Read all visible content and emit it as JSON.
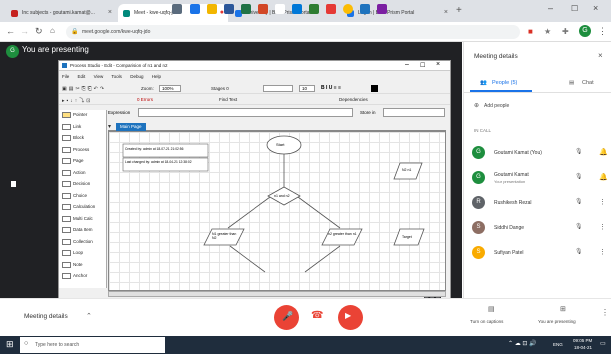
{
  "browser": {
    "tabs": [
      {
        "title": "Inc subjects - goutami.kamat@...",
        "color": "#c5221f"
      },
      {
        "title": "Meet - kwe-uqfq-jdo",
        "color": "#00897b"
      },
      {
        "title": "University | Blue Prism Portal",
        "color": "#1a73e8"
      },
      {
        "title": "Log in | Blue Prism Portal",
        "color": "#1a73e8"
      }
    ],
    "url": "meet.google.com/kwe-uqfq-jdo"
  },
  "meet": {
    "presenting_banner": "You are presenting",
    "presenter_initial": "G",
    "panel_title": "Meeting details",
    "panel_tabs": [
      "People (5)",
      "Chat"
    ],
    "add_people": "Add people",
    "in_call_label": "IN CALL",
    "participants": [
      {
        "name": "Goutami Kamat (You)",
        "sub": "",
        "initial": "G",
        "color": "#1e8e3e"
      },
      {
        "name": "Goutami Kamat",
        "sub": "Your presentation",
        "initial": "G",
        "color": "#1e8e3e"
      },
      {
        "name": "Rushikesh Rezal",
        "sub": "",
        "initial": "R",
        "color": "#5f6368"
      },
      {
        "name": "Siddhi Dange",
        "sub": "",
        "initial": "S",
        "color": "#8d6e63"
      },
      {
        "name": "Sufiyan Patel",
        "sub": "",
        "initial": "S",
        "color": "#f9ab00"
      }
    ],
    "bottom": {
      "meeting_details": "Meeting details",
      "captions": "Turn on captions",
      "presenting": "You are presenting"
    }
  },
  "process_studio": {
    "title": "Process Studio - Edit - Comparision of n1 and n2",
    "menu": [
      "File",
      "Edit",
      "View",
      "Tools",
      "Debug",
      "Help"
    ],
    "zoom_label": "Zoom:",
    "zoom_value": "100%",
    "stage_label": "Stages 0",
    "font_size": "10",
    "dependencies": "Dependencies",
    "errors_label": "0 Errors",
    "find_text": "Find Text",
    "expression_label": "Expression",
    "store_in_label": "Store in",
    "page_tab": "Main Page",
    "palette": [
      "Pointer",
      "Link",
      "Block",
      "Process",
      "Page",
      "Action",
      "Decision",
      "Choice",
      "Calculation",
      "Multi Calc",
      "Data Item",
      "Collection",
      "Loop",
      "Note",
      "Anchor"
    ],
    "note1": "Created by: admin at 18-07-21 21:02:56",
    "note2": "Last changed by: admin at 18-04-21 12:38:02",
    "start_label": "Start",
    "decision_label": "n1 and n2",
    "left_branch": "N1 greater than N2",
    "right_branch": "n2 greater than n1",
    "right_box1": "N2 n1",
    "right_box2": "Target"
  },
  "taskbar": {
    "search_placeholder": "Type here to search",
    "time": "09:05 PM",
    "date": "18-04-21",
    "lang": "ENG"
  }
}
